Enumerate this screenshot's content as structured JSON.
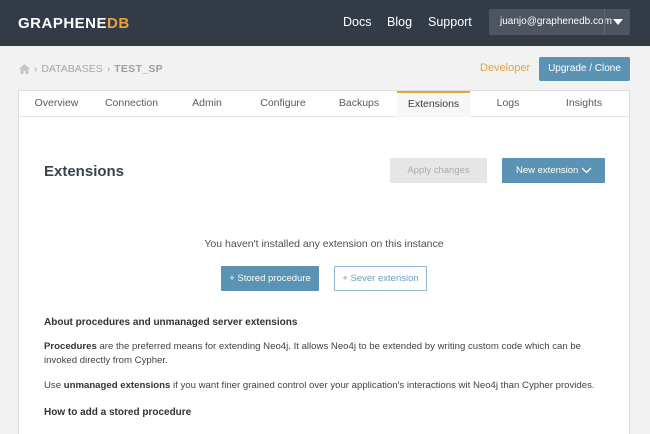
{
  "header": {
    "logo_main": "GRAPHENE",
    "logo_accent": "DB",
    "nav": [
      "Docs",
      "Blog",
      "Support"
    ],
    "account_email": "juanjo@graphenedb.com"
  },
  "breadcrumb": {
    "section": "DATABASES",
    "current": "TEST_SP"
  },
  "plan_label": "Developer",
  "upgrade_label": "Upgrade / Clone",
  "tabs": [
    "Overview",
    "Connection",
    "Admin",
    "Configure",
    "Backups",
    "Extensions",
    "Logs",
    "Insights"
  ],
  "active_tab": "Extensions",
  "page": {
    "title": "Extensions",
    "apply_label": "Apply changes",
    "new_label": "New extension",
    "empty_message": "You haven't installed any extension on this instance",
    "stored_label": "+ Stored procedure",
    "server_label": "+ Sever extension"
  },
  "info": {
    "about_title": "About procedures and unmanaged server extensions",
    "proc_term": "Procedures",
    "proc_text": " are the preferred means for extending Neo4j. It allows Neo4j to be extended by writing custom code which can be invoked directly from Cypher.",
    "unmanaged_prefix": "Use ",
    "unmanaged_term": "unmanaged extensions",
    "unmanaged_text": " if you want finer grained control over your application's interactions wit Neo4j than Cypher provides.",
    "howto_title": "How to add a stored procedure"
  },
  "colors": {
    "topbar": "#333c46",
    "accent_orange": "#e8a33d",
    "primary_blue": "#5a93b3"
  }
}
